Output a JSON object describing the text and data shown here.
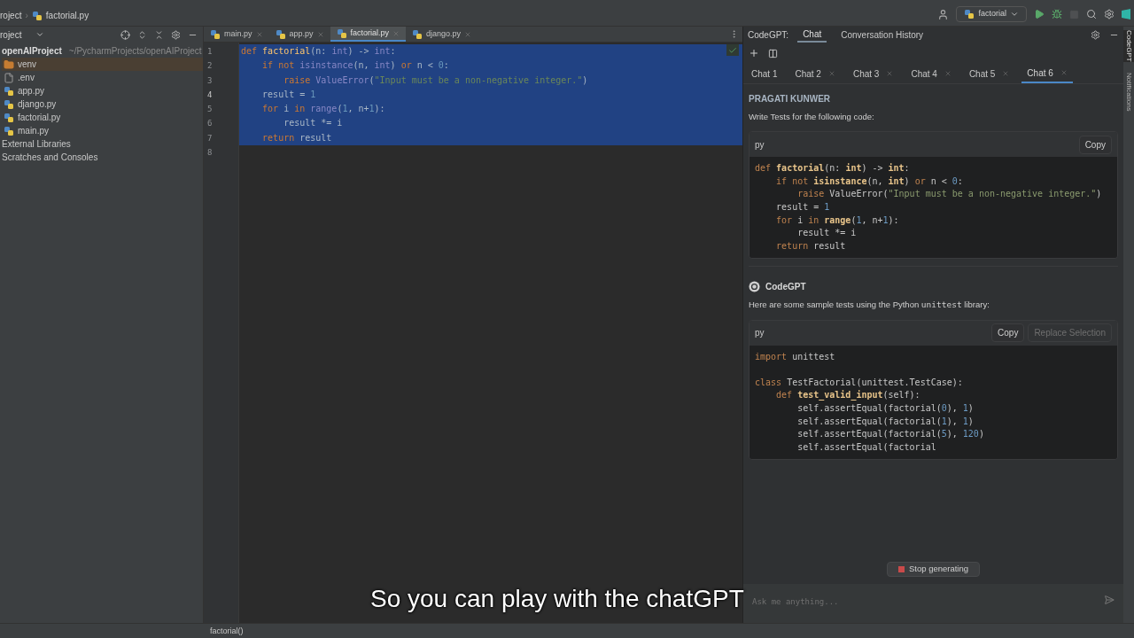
{
  "top_bar": {
    "project_label": "roject",
    "separator": "›",
    "breadcrumb": "factorial.py",
    "run_config": "factorial",
    "stop_disabled": true
  },
  "project_panel": {
    "title": "roject",
    "tree": [
      {
        "label": "openAIProject",
        "path": "~/PycharmProjects/openAIProject",
        "kind": "root",
        "selected": false,
        "children": [
          {
            "label": "venv",
            "kind": "folder",
            "selected": true
          },
          {
            "label": ".env",
            "kind": "file",
            "selected": false
          },
          {
            "label": "app.py",
            "kind": "python",
            "selected": false
          },
          {
            "label": "django.py",
            "kind": "python",
            "selected": false
          },
          {
            "label": "factorial.py",
            "kind": "python",
            "selected": false
          },
          {
            "label": "main.py",
            "kind": "python",
            "selected": false
          }
        ]
      },
      {
        "label": "External Libraries",
        "kind": "plain",
        "selected": false
      },
      {
        "label": "Scratches and Consoles",
        "kind": "plain",
        "selected": false
      }
    ]
  },
  "editor": {
    "tabs": [
      {
        "label": "main.py",
        "selected": false
      },
      {
        "label": "app.py",
        "selected": false
      },
      {
        "label": "factorial.py",
        "selected": true
      },
      {
        "label": "django.py",
        "selected": false
      }
    ],
    "lines": [
      {
        "number": "1",
        "selected": true,
        "current": false,
        "tokens": [
          {
            "kind": "kw",
            "text": "def "
          },
          {
            "kind": "fn",
            "text": "factorial"
          },
          {
            "kind": "plain",
            "text": "(n: "
          },
          {
            "kind": "builtin",
            "text": "int"
          },
          {
            "kind": "plain",
            "text": ") -> "
          },
          {
            "kind": "builtin",
            "text": "int"
          },
          {
            "kind": "plain",
            "text": ":"
          }
        ]
      },
      {
        "number": "2",
        "selected": true,
        "current": false,
        "tokens": [
          {
            "kind": "kw",
            "text": "    if not "
          },
          {
            "kind": "builtin",
            "text": "isinstance"
          },
          {
            "kind": "plain",
            "text": "(n, "
          },
          {
            "kind": "builtin",
            "text": "int"
          },
          {
            "kind": "plain",
            "text": ") "
          },
          {
            "kind": "kw",
            "text": "or "
          },
          {
            "kind": "plain",
            "text": "n < "
          },
          {
            "kind": "num",
            "text": "0"
          },
          {
            "kind": "plain",
            "text": ":"
          }
        ]
      },
      {
        "number": "3",
        "selected": true,
        "current": false,
        "tokens": [
          {
            "kind": "kw",
            "text": "        raise "
          },
          {
            "kind": "builtin",
            "text": "ValueError"
          },
          {
            "kind": "plain",
            "text": "("
          },
          {
            "kind": "str",
            "text": "\"Input must be a non-negative integer.\""
          },
          {
            "kind": "plain",
            "text": ")"
          }
        ]
      },
      {
        "number": "4",
        "selected": true,
        "current": true,
        "tokens": [
          {
            "kind": "plain",
            "text": "    result = "
          },
          {
            "kind": "num",
            "text": "1"
          }
        ]
      },
      {
        "number": "5",
        "selected": true,
        "current": false,
        "tokens": [
          {
            "kind": "kw",
            "text": "    for "
          },
          {
            "kind": "plain",
            "text": "i "
          },
          {
            "kind": "kw",
            "text": "in "
          },
          {
            "kind": "builtin",
            "text": "range"
          },
          {
            "kind": "plain",
            "text": "("
          },
          {
            "kind": "num",
            "text": "1"
          },
          {
            "kind": "plain",
            "text": ", n+"
          },
          {
            "kind": "num",
            "text": "1"
          },
          {
            "kind": "plain",
            "text": "):"
          }
        ]
      },
      {
        "number": "6",
        "selected": true,
        "current": false,
        "tokens": [
          {
            "kind": "plain",
            "text": "        result *= i"
          }
        ]
      },
      {
        "number": "7",
        "selected": true,
        "current": false,
        "tokens": [
          {
            "kind": "kw",
            "text": "    return "
          },
          {
            "kind": "plain",
            "text": "result"
          }
        ]
      },
      {
        "number": "8",
        "selected": false,
        "current": false
      }
    ]
  },
  "chat_panel": {
    "label": "CodeGPT:",
    "tabs": [
      {
        "label": "Chat",
        "selected": true
      },
      {
        "label": "Conversation History",
        "selected": false
      }
    ],
    "chats": [
      {
        "label": "Chat 1",
        "selected": false,
        "closable": false
      },
      {
        "label": "Chat 2",
        "selected": false,
        "closable": true
      },
      {
        "label": "Chat 3",
        "selected": false,
        "closable": true
      },
      {
        "label": "Chat 4",
        "selected": false,
        "closable": true
      },
      {
        "label": "Chat 5",
        "selected": false,
        "closable": true
      },
      {
        "label": "Chat 6",
        "selected": true,
        "closable": true
      }
    ],
    "messages": [
      {
        "kind": "user",
        "author": "PRAGATI KUNWER",
        "text": [
          {
            "kind": "text",
            "text": "Write Tests for the following code:"
          }
        ],
        "code": {
          "language": "py",
          "buttons": [
            {
              "label": "Copy",
              "disabled": false
            }
          ],
          "lines": [
            [
              {
                "kind": "kw",
                "text": "def "
              },
              {
                "kind": "fn",
                "text": "factorial"
              },
              {
                "kind": "plain",
                "text": "(n: "
              },
              {
                "kind": "fn",
                "text": "int"
              },
              {
                "kind": "plain",
                "text": ") -> "
              },
              {
                "kind": "fn",
                "text": "int"
              },
              {
                "kind": "plain",
                "text": ":"
              }
            ],
            [
              {
                "kind": "kw",
                "text": "    if not "
              },
              {
                "kind": "fn",
                "text": "isinstance"
              },
              {
                "kind": "plain",
                "text": "(n, "
              },
              {
                "kind": "fn",
                "text": "int"
              },
              {
                "kind": "plain",
                "text": ") "
              },
              {
                "kind": "kw",
                "text": "or "
              },
              {
                "kind": "plain",
                "text": "n < "
              },
              {
                "kind": "num",
                "text": "0"
              },
              {
                "kind": "plain",
                "text": ":"
              }
            ],
            [
              {
                "kind": "kw",
                "text": "        raise "
              },
              {
                "kind": "plain",
                "text": "ValueError("
              },
              {
                "kind": "str",
                "text": "\"Input must be a non-negative integer.\""
              },
              {
                "kind": "plain",
                "text": ")"
              }
            ],
            [
              {
                "kind": "plain",
                "text": "    result = "
              },
              {
                "kind": "num",
                "text": "1"
              }
            ],
            [
              {
                "kind": "kw",
                "text": "    for "
              },
              {
                "kind": "plain",
                "text": "i "
              },
              {
                "kind": "kw",
                "text": "in "
              },
              {
                "kind": "fn",
                "text": "range"
              },
              {
                "kind": "plain",
                "text": "("
              },
              {
                "kind": "num",
                "text": "1"
              },
              {
                "kind": "plain",
                "text": ", n+"
              },
              {
                "kind": "num",
                "text": "1"
              },
              {
                "kind": "plain",
                "text": "):"
              }
            ],
            [
              {
                "kind": "plain",
                "text": "        result *= i"
              }
            ],
            [
              {
                "kind": "kw",
                "text": "    return "
              },
              {
                "kind": "plain",
                "text": "result"
              }
            ]
          ]
        }
      },
      {
        "kind": "bot",
        "author": "CodeGPT",
        "text": [
          {
            "kind": "text",
            "text": "Here are some sample tests using the Python "
          },
          {
            "kind": "code",
            "text": "unittest"
          },
          {
            "kind": "text",
            "text": " library:"
          }
        ],
        "code": {
          "language": "py",
          "buttons": [
            {
              "label": "Copy",
              "disabled": false
            },
            {
              "label": "Replace Selection",
              "disabled": true
            }
          ],
          "lines": [
            [
              {
                "kind": "kw",
                "text": "import "
              },
              {
                "kind": "plain",
                "text": "unittest"
              }
            ],
            [
              {
                "kind": "blank"
              }
            ],
            [
              {
                "kind": "kw",
                "text": "class "
              },
              {
                "kind": "plain",
                "text": "TestFactorial(unittest.TestCase):"
              }
            ],
            [
              {
                "kind": "kw",
                "text": "    def "
              },
              {
                "kind": "fn",
                "text": "test_valid_input"
              },
              {
                "kind": "plain",
                "text": "(self):"
              }
            ],
            [
              {
                "kind": "plain",
                "text": "        self.assertEqual(factorial("
              },
              {
                "kind": "num",
                "text": "0"
              },
              {
                "kind": "plain",
                "text": "), "
              },
              {
                "kind": "num",
                "text": "1"
              },
              {
                "kind": "plain",
                "text": ")"
              }
            ],
            [
              {
                "kind": "plain",
                "text": "        self.assertEqual(factorial("
              },
              {
                "kind": "num",
                "text": "1"
              },
              {
                "kind": "plain",
                "text": "), "
              },
              {
                "kind": "num",
                "text": "1"
              },
              {
                "kind": "plain",
                "text": ")"
              }
            ],
            [
              {
                "kind": "plain",
                "text": "        self.assertEqual(factorial("
              },
              {
                "kind": "num",
                "text": "5"
              },
              {
                "kind": "plain",
                "text": "), "
              },
              {
                "kind": "num",
                "text": "120"
              },
              {
                "kind": "plain",
                "text": ")"
              }
            ],
            [
              {
                "kind": "plain",
                "text": "        self.assertEqual(factorial"
              }
            ]
          ]
        }
      }
    ],
    "stop_button": "Stop generating",
    "input": {
      "placeholder": "Ask me anything..."
    }
  },
  "side_strip": [
    "CodeGPT",
    "Notifications"
  ],
  "status_bar": {
    "text": "factorial()"
  },
  "caption": "So you can play with the chatGPT"
}
